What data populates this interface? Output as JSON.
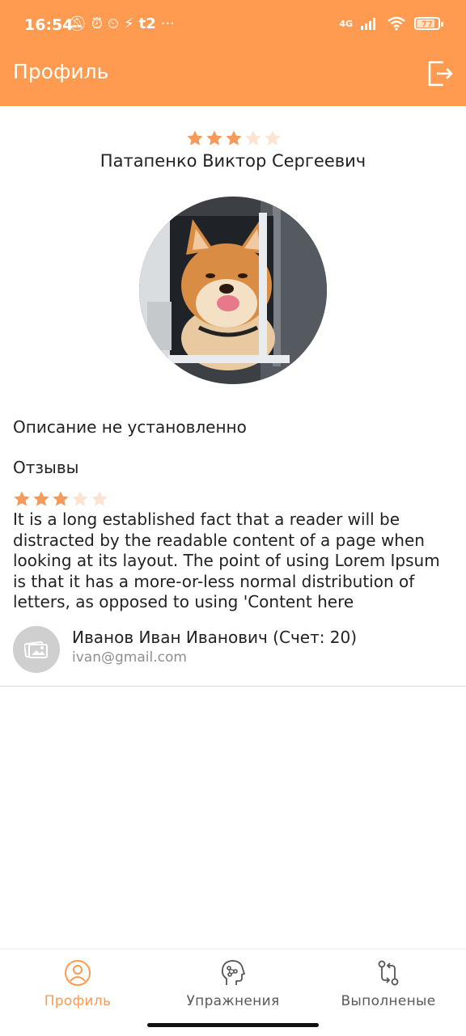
{
  "status_bar": {
    "time": "16:54",
    "net": "4G",
    "battery": "77"
  },
  "app_bar": {
    "title": "Профиль"
  },
  "profile": {
    "rating": 3,
    "rating_max": 5,
    "name": "Патапенко Виктор Сергеевич",
    "description": "Описание не установленно"
  },
  "reviews": {
    "title": "Отзывы",
    "items": [
      {
        "rating": 3,
        "text": "It is a long established fact that a reader will be distracted by the readable content of a page when looking at its layout. The point of using Lorem Ipsum is that it has a more-or-less normal distribution of letters, as opposed to using 'Content here",
        "author": "Иванов Иван Иванович (Счет: 20)",
        "email": "ivan@gmail.com"
      }
    ]
  },
  "bottom_nav": {
    "items": [
      {
        "label": "Профиль",
        "icon": "profile-icon",
        "active": true
      },
      {
        "label": "Упражнения",
        "icon": "head-brain-icon",
        "active": false
      },
      {
        "label": "Выполненые",
        "icon": "git-compare-icon",
        "active": false
      }
    ]
  },
  "colors": {
    "accent": "#FF9B50",
    "star_filled": "#F49A5A",
    "star_empty": "#FCE3D2"
  }
}
